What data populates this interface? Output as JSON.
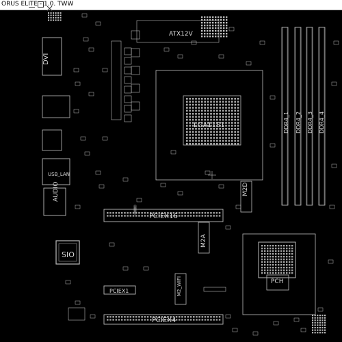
{
  "window": {
    "title": "ORUS ELITE - 1.0. TWW",
    "icons": [
      "minimize-icon",
      "restore-icon",
      "close-icon"
    ]
  },
  "board": {
    "labels": {
      "dvi": "DVI",
      "sio": "SIO",
      "audio": "AUDIO",
      "usb_lan": "USB_LAN",
      "lga": "LGA1151",
      "pciex16": "PCIEX16",
      "pciex4": "PCIEX4",
      "pciex1": "PCIEX1",
      "m2a": "M2A",
      "m2d": "M2D",
      "m2_wifi": "M2_WIFI",
      "ddr4_1": "DDR4_1",
      "ddr4_2": "DDR4_2",
      "ddr4_3": "DDR4_3",
      "ddr4_4": "DDR4_4",
      "atx12v": "ATX12V",
      "pch": "PCH"
    }
  }
}
